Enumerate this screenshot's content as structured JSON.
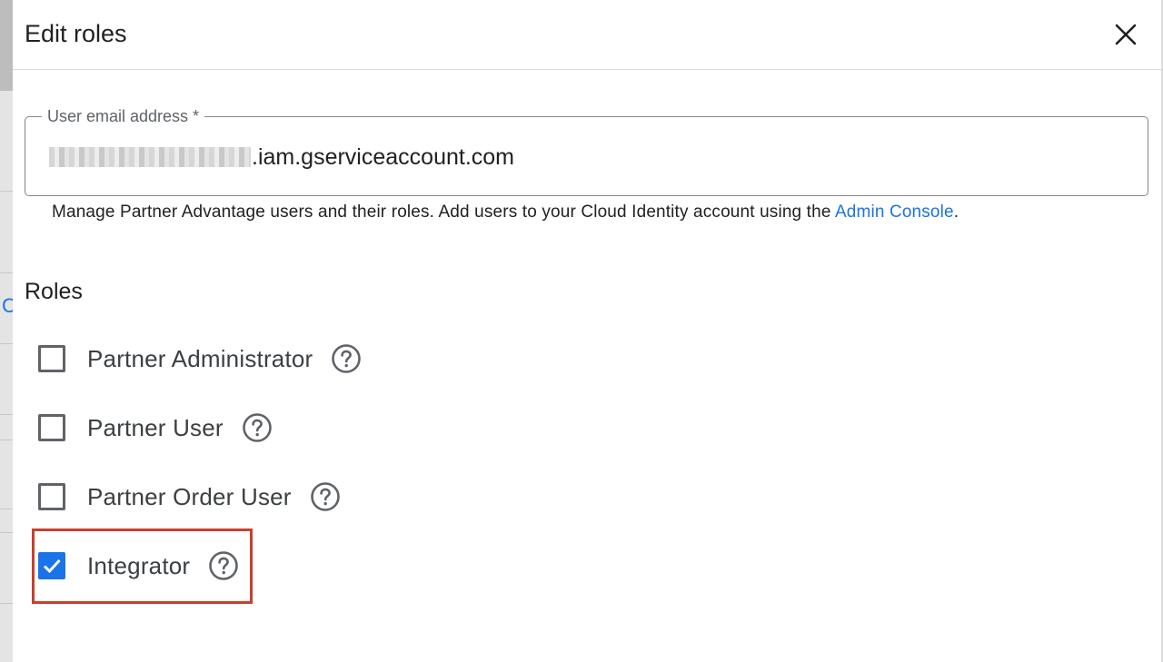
{
  "dialog": {
    "title": "Edit roles",
    "close_icon": "close-icon"
  },
  "email_field": {
    "label": "User email address *",
    "value_suffix": ".iam.gserviceaccount.com"
  },
  "help": {
    "text": "Manage Partner Advantage users and their roles. Add users to your Cloud Identity account using the ",
    "link_text": "Admin Console",
    "trailing": "."
  },
  "roles": {
    "heading": "Roles",
    "items": [
      {
        "label": "Partner Administrator",
        "checked": false
      },
      {
        "label": "Partner User",
        "checked": false
      },
      {
        "label": "Partner Order User",
        "checked": false
      },
      {
        "label": "Integrator",
        "checked": true
      }
    ]
  },
  "background": {
    "peek_text": "C"
  },
  "colors": {
    "accent": "#1a73e8",
    "highlight": "#c6402d"
  }
}
